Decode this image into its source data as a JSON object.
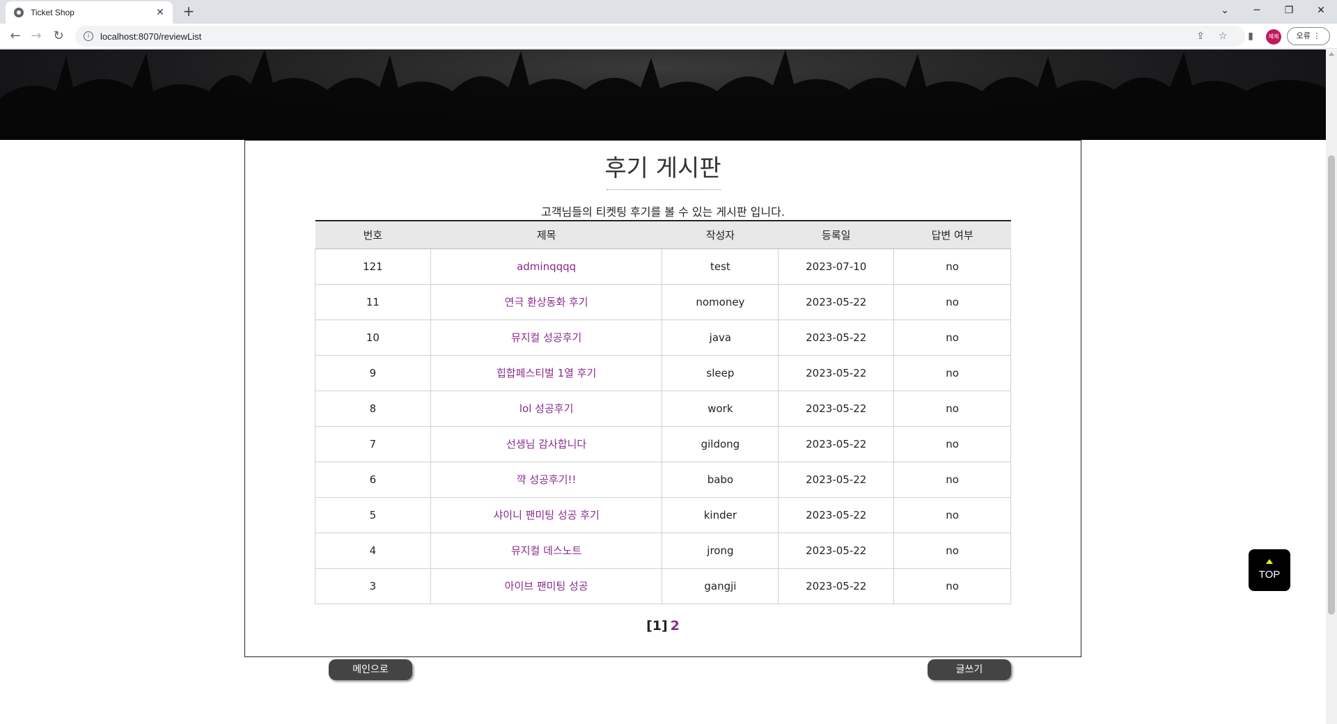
{
  "browser": {
    "tab_title": "Ticket Shop",
    "tab_close": "✕",
    "new_tab": "+",
    "url": "localhost:8070/reviewList",
    "profile_label": "제제",
    "error_button": "오류"
  },
  "page": {
    "title": "후기 게시판",
    "description": "고객님들의 티켓팅 후기를 볼 수 있는 게시판 입니다."
  },
  "table": {
    "headers": [
      "번호",
      "제목",
      "작성자",
      "등록일",
      "답변 여부"
    ],
    "rows": [
      {
        "no": "121",
        "title": "adminqqqq",
        "writer": "test",
        "date": "2023-07-10",
        "answered": "no"
      },
      {
        "no": "11",
        "title": "연극 환상동화 후기",
        "writer": "nomoney",
        "date": "2023-05-22",
        "answered": "no"
      },
      {
        "no": "10",
        "title": "뮤지컬 성공후기",
        "writer": "java",
        "date": "2023-05-22",
        "answered": "no"
      },
      {
        "no": "9",
        "title": "힙합페스티벌 1열 후기",
        "writer": "sleep",
        "date": "2023-05-22",
        "answered": "no"
      },
      {
        "no": "8",
        "title": "lol 성공후기",
        "writer": "work",
        "date": "2023-05-22",
        "answered": "no"
      },
      {
        "no": "7",
        "title": "선생님 감사합니다",
        "writer": "gildong",
        "date": "2023-05-22",
        "answered": "no"
      },
      {
        "no": "6",
        "title": "꺅 성공후기!!",
        "writer": "babo",
        "date": "2023-05-22",
        "answered": "no"
      },
      {
        "no": "5",
        "title": "샤이니 팬미팅 성공 후기",
        "writer": "kinder",
        "date": "2023-05-22",
        "answered": "no"
      },
      {
        "no": "4",
        "title": "뮤지컬 데스노트",
        "writer": "jrong",
        "date": "2023-05-22",
        "answered": "no"
      },
      {
        "no": "3",
        "title": "아이브 팬미팅 성공",
        "writer": "gangji",
        "date": "2023-05-22",
        "answered": "no"
      }
    ]
  },
  "pagination": {
    "current": "[1]",
    "next": "2"
  },
  "buttons": {
    "main": "메인으로",
    "write": "글쓰기",
    "top": "TOP"
  },
  "colors": {
    "link": "#8a2b8e",
    "button_bg": "#444444",
    "top_button_bg": "#000000",
    "top_arrow": "#e8f500"
  }
}
